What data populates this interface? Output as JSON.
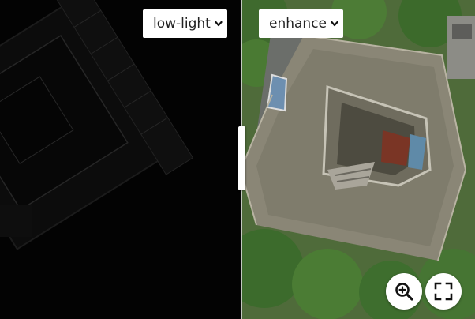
{
  "left_select": {
    "value": "low-light",
    "options_visible": [
      "low-light"
    ]
  },
  "right_select": {
    "value": "enhance",
    "options_visible": [
      "enhance"
    ]
  },
  "icons": {
    "select_chevron": "chevron-down-icon",
    "zoom": "zoom-in-icon",
    "fullscreen": "fullscreen-icon"
  },
  "colors": {
    "control_bg": "#ffffff",
    "icon": "#111111",
    "divider": "#d8d8d8"
  }
}
